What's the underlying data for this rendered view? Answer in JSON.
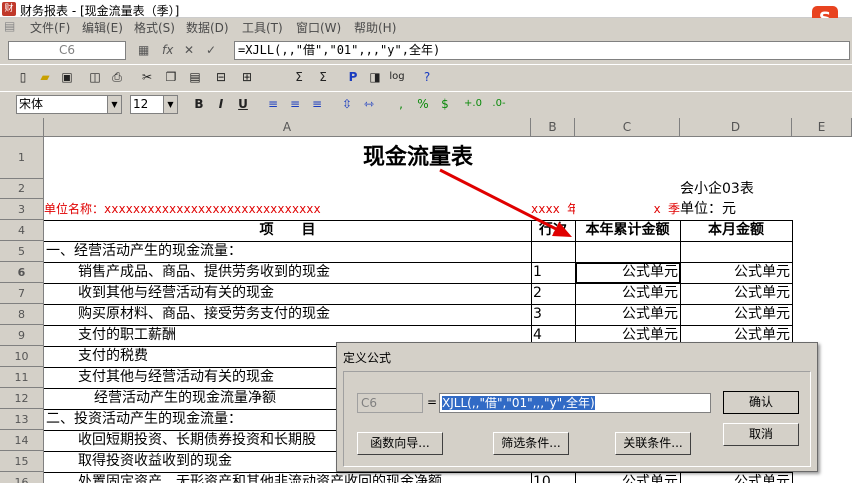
{
  "window": {
    "title": "财务报表 - [现金流量表（季）]",
    "logo": "S"
  },
  "menu": [
    "文件(F)",
    "编辑(E)",
    "格式(S)",
    "数据(D)",
    "工具(T)",
    "窗口(W)",
    "帮助(H)"
  ],
  "formula_bar": {
    "cell_ref": "C6",
    "fx": "fx",
    "cancel": "✕",
    "accept": "✓",
    "formula": "=XJLL(,,\"借\",\"01\",,,\"y\",全年)"
  },
  "toolbar2": {
    "font": "宋体",
    "size": "12",
    "bold": "B",
    "italic": "I",
    "underline": "U",
    "currency": "$",
    "percent": "%"
  },
  "columns": [
    "A",
    "B",
    "C",
    "D",
    "E"
  ],
  "rows": [
    "1",
    "2",
    "3",
    "4",
    "5",
    "6",
    "7",
    "8",
    "9",
    "10",
    "11",
    "12",
    "13",
    "14",
    "15",
    "16"
  ],
  "sheet": {
    "title": "现金流量表",
    "form_no": "会小企03表",
    "unit_name": "单位名称：xxxxxxxxxxxxxxxxxxxxxxxxxxxxxx",
    "year": "xxxx 年",
    "quarter": "x 季",
    "unit": "单位：元",
    "headers": {
      "item": "项　　目",
      "line": "行次",
      "ytd": "本年累计金额",
      "month": "本月金额"
    },
    "items": [
      {
        "text": "一、经营活动产生的现金流量：",
        "line": "",
        "ytd": "",
        "month": ""
      },
      {
        "text": "销售产成品、商品、提供劳务收到的现金",
        "line": "1",
        "ytd": "公式单元",
        "month": "公式单元"
      },
      {
        "text": "收到其他与经营活动有关的现金",
        "line": "2",
        "ytd": "公式单元",
        "month": "公式单元"
      },
      {
        "text": "购买原材料、商品、接受劳务支付的现金",
        "line": "3",
        "ytd": "公式单元",
        "month": "公式单元"
      },
      {
        "text": "支付的职工薪酬",
        "line": "4",
        "ytd": "公式单元",
        "month": "公式单元"
      },
      {
        "text": "支付的税费",
        "line": "",
        "ytd": "",
        "month": ""
      },
      {
        "text": "支付其他与经营活动有关的现金",
        "line": "",
        "ytd": "",
        "month": ""
      },
      {
        "text": "经营活动产生的现金流量净额",
        "line": "",
        "ytd": "",
        "month": ""
      },
      {
        "text": "二、投资活动产生的现金流量：",
        "line": "",
        "ytd": "",
        "month": ""
      },
      {
        "text": "收回短期投资、长期债券投资和长期股",
        "line": "",
        "ytd": "",
        "month": ""
      },
      {
        "text": "取得投资收益收到的现金",
        "line": "",
        "ytd": "",
        "month": ""
      },
      {
        "text": "处置固定资产、无形资产和其他非流动资产收回的现金净额",
        "line": "10",
        "ytd": "公式单元",
        "month": "公式单元"
      }
    ]
  },
  "dialog": {
    "title": "定义公式",
    "cell": "C6",
    "eq": "=",
    "formula": "XJLL(,,\"借\",\"01\",,,\"y\",全年)",
    "buttons": {
      "ok": "确认",
      "cancel": "取消",
      "wizard": "函数向导...",
      "filter": "筛选条件...",
      "relate": "关联条件..."
    }
  },
  "colors": {
    "red": "#e00000",
    "highlight": "#316ac5",
    "grid_bg": "#ffffff",
    "chrome": "#d4d0c8"
  }
}
